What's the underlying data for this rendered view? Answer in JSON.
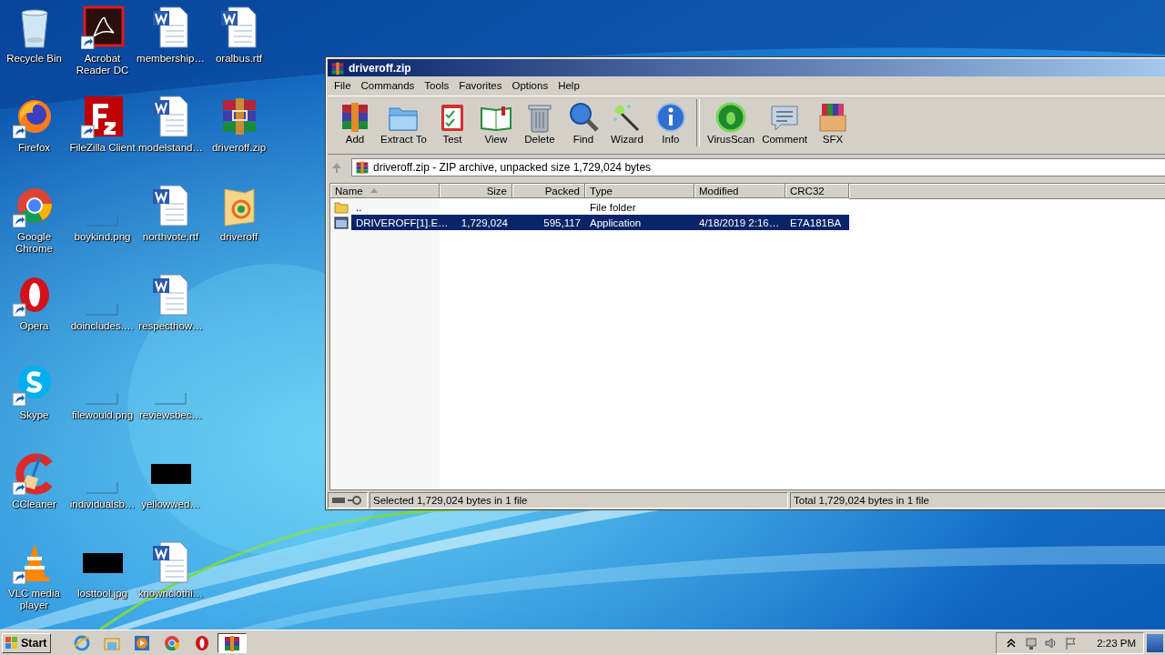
{
  "desktop": {
    "icons": [
      {
        "label": "Recycle Bin",
        "kind": "recycle",
        "shortcut": false
      },
      {
        "label": "Firefox",
        "kind": "firefox",
        "shortcut": true
      },
      {
        "label": "Google Chrome",
        "kind": "chrome",
        "shortcut": true
      },
      {
        "label": "Opera",
        "kind": "opera",
        "shortcut": true
      },
      {
        "label": "Skype",
        "kind": "skype",
        "shortcut": true
      },
      {
        "label": "CCleaner",
        "kind": "ccleaner",
        "shortcut": true
      },
      {
        "label": "VLC media player",
        "kind": "vlc",
        "shortcut": true
      },
      {
        "label": "Acrobat Reader DC",
        "kind": "acrobat",
        "shortcut": true
      },
      {
        "label": "FileZilla Client",
        "kind": "filezilla",
        "shortcut": true
      },
      {
        "label": "boykind.png",
        "kind": "blank",
        "shortcut": false
      },
      {
        "label": "doincludes.…",
        "kind": "blank",
        "shortcut": false
      },
      {
        "label": "filewould.png",
        "kind": "blank",
        "shortcut": false
      },
      {
        "label": "individualsb…",
        "kind": "blank",
        "shortcut": false
      },
      {
        "label": "losttool.jpg",
        "kind": "black",
        "shortcut": false
      },
      {
        "label": "membership…",
        "kind": "word",
        "shortcut": false
      },
      {
        "label": "modelstand…",
        "kind": "word",
        "shortcut": false
      },
      {
        "label": "northvote.rtf",
        "kind": "word",
        "shortcut": false
      },
      {
        "label": "respecthow…",
        "kind": "word",
        "shortcut": false
      },
      {
        "label": "reviewsbec…",
        "kind": "blank",
        "shortcut": false
      },
      {
        "label": "yellowwed…",
        "kind": "black",
        "shortcut": false
      },
      {
        "label": "knownclothi…",
        "kind": "word",
        "shortcut": false
      },
      {
        "label": "oralbus.rtf",
        "kind": "word",
        "shortcut": false
      },
      {
        "label": "driveroff.zip",
        "kind": "winrar",
        "shortcut": false
      },
      {
        "label": "driveroff",
        "kind": "folder",
        "shortcut": false
      }
    ]
  },
  "window": {
    "title": "driveroff.zip",
    "menu": [
      "File",
      "Commands",
      "Tools",
      "Favorites",
      "Options",
      "Help"
    ],
    "toolbar": [
      {
        "label": "Add",
        "kind": "add",
        "separator_before": false
      },
      {
        "label": "Extract To",
        "kind": "extract",
        "separator_before": false
      },
      {
        "label": "Test",
        "kind": "test",
        "separator_before": false
      },
      {
        "label": "View",
        "kind": "view",
        "separator_before": false
      },
      {
        "label": "Delete",
        "kind": "delete",
        "separator_before": false
      },
      {
        "label": "Find",
        "kind": "find",
        "separator_before": false
      },
      {
        "label": "Wizard",
        "kind": "wizard",
        "separator_before": false
      },
      {
        "label": "Info",
        "kind": "info",
        "separator_before": false
      },
      {
        "label": "VirusScan",
        "kind": "virus",
        "separator_before": true
      },
      {
        "label": "Comment",
        "kind": "comment",
        "separator_before": false
      },
      {
        "label": "SFX",
        "kind": "sfx",
        "separator_before": false
      }
    ],
    "address": "driveroff.zip - ZIP archive, unpacked size 1,729,024 bytes",
    "columns": [
      {
        "label": "Name",
        "sorted": true
      },
      {
        "label": "Size",
        "sorted": false
      },
      {
        "label": "Packed",
        "sorted": false
      },
      {
        "label": "Type",
        "sorted": false
      },
      {
        "label": "Modified",
        "sorted": false
      },
      {
        "label": "CRC32",
        "sorted": false
      }
    ],
    "rows": [
      {
        "kind": "folder",
        "selected": false,
        "cells": [
          "..",
          null,
          null,
          "File folder",
          null,
          null
        ]
      },
      {
        "kind": "app",
        "selected": true,
        "cells": [
          "DRIVEROFF[1].E…",
          "1,729,024",
          "595,117",
          "Application",
          "4/18/2019 2:16…",
          "E7A181BA"
        ]
      }
    ],
    "status": {
      "selected": "Selected 1,729,024 bytes in 1 file",
      "total": "Total 1,729,024 bytes in 1 file"
    }
  },
  "taskbar": {
    "start": "Start",
    "apps": [
      {
        "kind": "ie",
        "active": false
      },
      {
        "kind": "explorer",
        "active": false
      },
      {
        "kind": "media",
        "active": false
      },
      {
        "kind": "chrome",
        "active": false
      },
      {
        "kind": "opera",
        "active": false
      },
      {
        "kind": "winrar",
        "active": true
      }
    ],
    "clock": "2:23 PM"
  }
}
